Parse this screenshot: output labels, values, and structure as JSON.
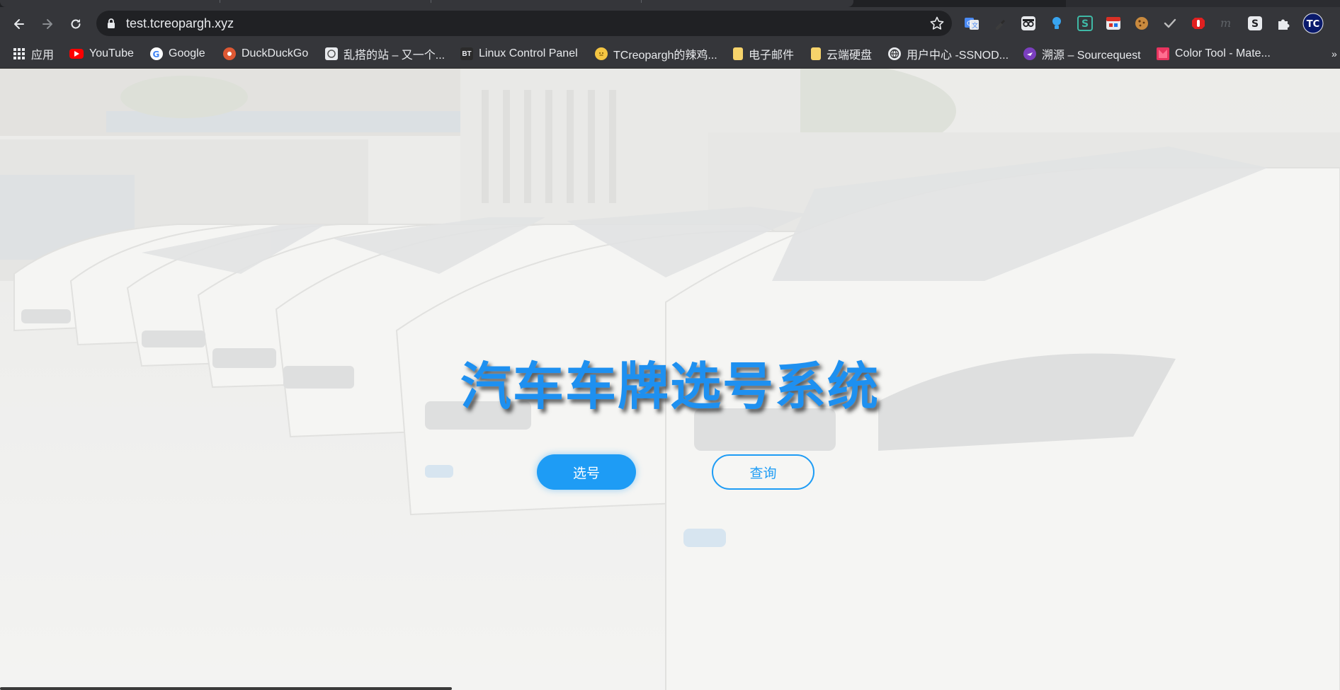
{
  "browser": {
    "url": "test.tcreopargh.xyz",
    "bookmarks": [
      {
        "label": "应用",
        "icon": "apps-icon"
      },
      {
        "label": "YouTube",
        "icon": "youtube-icon",
        "color": "#ff0000"
      },
      {
        "label": "Google",
        "icon": "google-icon"
      },
      {
        "label": "DuckDuckGo",
        "icon": "duckduckgo-icon",
        "color": "#de5833"
      },
      {
        "label": "乱搭的站 – 又一个...",
        "icon": "site-icon"
      },
      {
        "label": "Linux Control Panel",
        "icon": "bt-icon",
        "badge": "BT"
      },
      {
        "label": "TCreopargh的辣鸡...",
        "icon": "emoji-icon"
      },
      {
        "label": "电子邮件",
        "icon": "folder-icon"
      },
      {
        "label": "云端硬盘",
        "icon": "folder-icon"
      },
      {
        "label": "用户中心 -SSNOD...",
        "icon": "globe-icon"
      },
      {
        "label": "溯源 – Sourcequest",
        "icon": "sourcequest-icon",
        "color": "#7b3fbf"
      },
      {
        "label": "Color Tool - Mate...",
        "icon": "material-icon",
        "color": "#e8345f"
      }
    ],
    "extensions": [
      "translate-icon",
      "dropper-icon",
      "glasses-icon",
      "bulb-icon",
      "s-icon",
      "calendar-icon",
      "cookie-icon",
      "check-icon",
      "stop-hand-icon",
      "m-icon",
      "s-square-icon",
      "puzzle-icon",
      "profile-avatar"
    ],
    "profile_initials": "TC"
  },
  "page": {
    "title": "汽车车牌选号系统",
    "select_button": "选号",
    "query_button": "查询"
  },
  "colors": {
    "accent": "#1e9cf5",
    "title": "#1e90f0",
    "chrome": "#35363a",
    "omnibox": "#202124"
  }
}
